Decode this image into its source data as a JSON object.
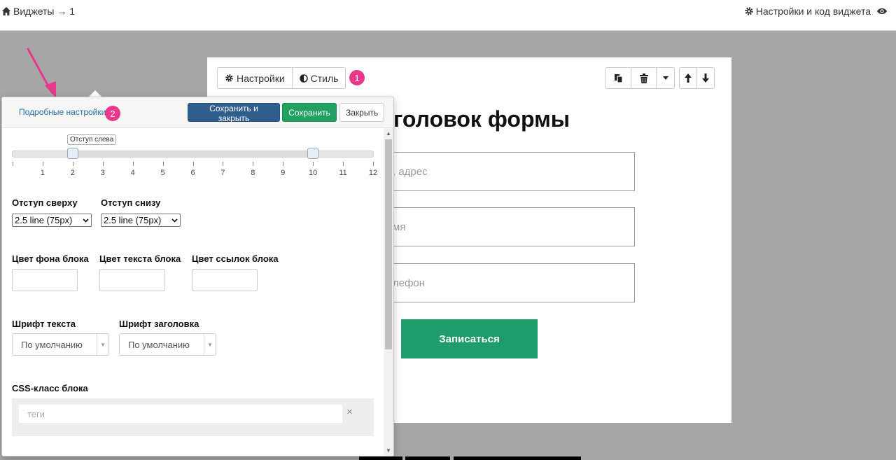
{
  "topbar": {
    "breadcrumb": "Виджеты → 1",
    "settings_label": "Настройки и код виджета",
    "icons": {
      "home": "home-icon",
      "gear": "gear-icon",
      "eye": "eye-icon"
    }
  },
  "preview": {
    "toolbar": {
      "settings_label": "Настройки",
      "style_label": "Стиль",
      "badge": "1"
    },
    "form_title": "головок формы",
    "fields": [
      {
        "placeholder": ". адрес"
      },
      {
        "placeholder": "мя"
      },
      {
        "placeholder": "лефон"
      }
    ],
    "submit_label": "Записаться"
  },
  "popover": {
    "detail_link": "Подробные настройки",
    "badge": "2",
    "save_close_label": "Сохранить и закрыть",
    "save_label": "Сохранить",
    "close_label": "Закрыть",
    "slider": {
      "tooltip": "Отступ слева",
      "min": 0,
      "max": 12,
      "value_left": 2,
      "value_right": 10,
      "ticks": [
        "1",
        "2",
        "3",
        "4",
        "5",
        "6",
        "7",
        "8",
        "9",
        "10",
        "11",
        "12"
      ]
    },
    "padding_top": {
      "label": "Отступ сверху",
      "value": "2.5 line (75px)"
    },
    "padding_bottom": {
      "label": "Отступ снизу",
      "value": "2.5 line (75px)"
    },
    "bg_color_label": "Цвет фона блока",
    "text_color_label": "Цвет текста блока",
    "link_color_label": "Цвет ссылок блока",
    "text_font": {
      "label": "Шрифт текста",
      "value": "По умолчанию"
    },
    "heading_font": {
      "label": "Шрифт заголовка",
      "value": "По умолчанию"
    },
    "css_class": {
      "label": "CSS-класс блока",
      "placeholder": "теги",
      "clear": "×"
    }
  },
  "colors": {
    "accent_blue": "#2f5d8c",
    "accent_green": "#20a162",
    "submit_green": "#1e9c6c",
    "badge_pink": "#e6398c",
    "link_blue": "#2b6fa6"
  }
}
